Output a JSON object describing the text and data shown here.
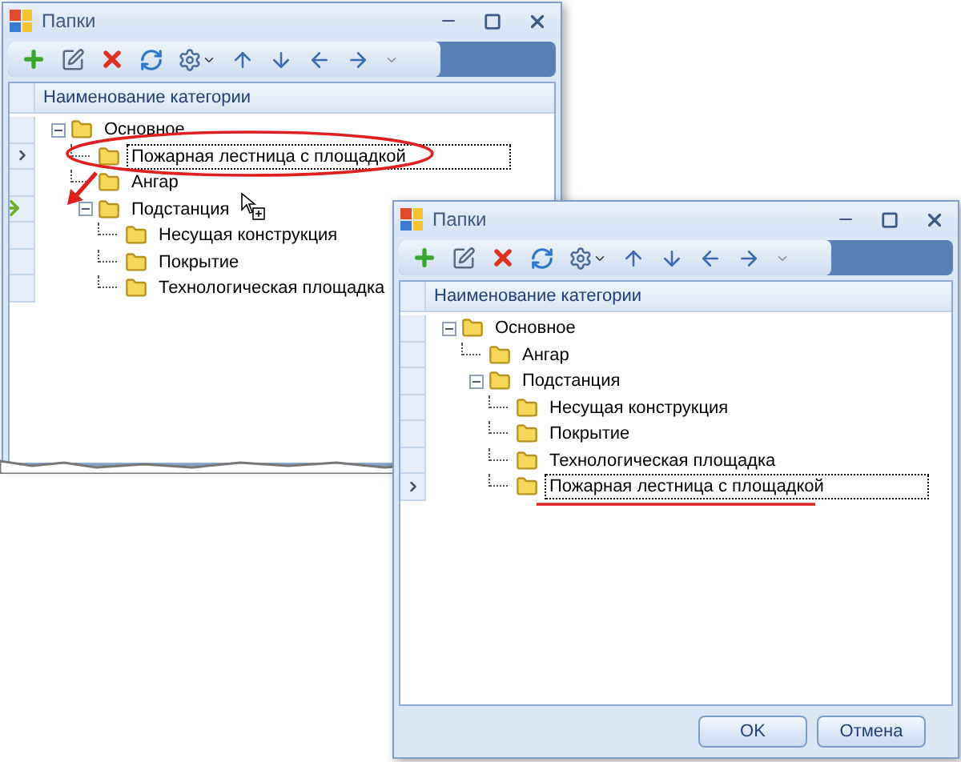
{
  "windows": [
    {
      "title": "Папки",
      "column_header": "Наименование категории",
      "tree": [
        {
          "label": "Основное",
          "expanded": true,
          "selected": false,
          "drop_target": false,
          "children": [
            {
              "label": "Пожарная лестница с площадкой",
              "selected": true,
              "drop_target": false
            },
            {
              "label": "Ангар",
              "selected": false,
              "drop_target": false
            },
            {
              "label": "Подстанция",
              "expanded": true,
              "selected": false,
              "drop_target": true,
              "children": [
                {
                  "label": "Несущая конструкция",
                  "selected": false,
                  "drop_target": false
                },
                {
                  "label": "Покрытие",
                  "selected": false,
                  "drop_target": false
                },
                {
                  "label": "Технологическая площадка",
                  "selected": false,
                  "drop_target": false
                }
              ]
            }
          ]
        }
      ]
    },
    {
      "title": "Папки",
      "column_header": "Наименование категории",
      "tree": [
        {
          "label": "Основное",
          "expanded": true,
          "selected": false,
          "drop_target": false,
          "children": [
            {
              "label": "Ангар",
              "selected": false,
              "drop_target": false
            },
            {
              "label": "Подстанция",
              "expanded": true,
              "selected": false,
              "drop_target": false,
              "children": [
                {
                  "label": "Несущая конструкция",
                  "selected": false,
                  "drop_target": false
                },
                {
                  "label": "Покрытие",
                  "selected": false,
                  "drop_target": false
                },
                {
                  "label": "Технологическая площадка",
                  "selected": false,
                  "drop_target": false
                },
                {
                  "label": "Пожарная лестница с площадкой",
                  "selected": true,
                  "drop_target": false
                }
              ]
            }
          ]
        }
      ],
      "buttons": [
        "OK",
        "Отмена"
      ]
    }
  ]
}
